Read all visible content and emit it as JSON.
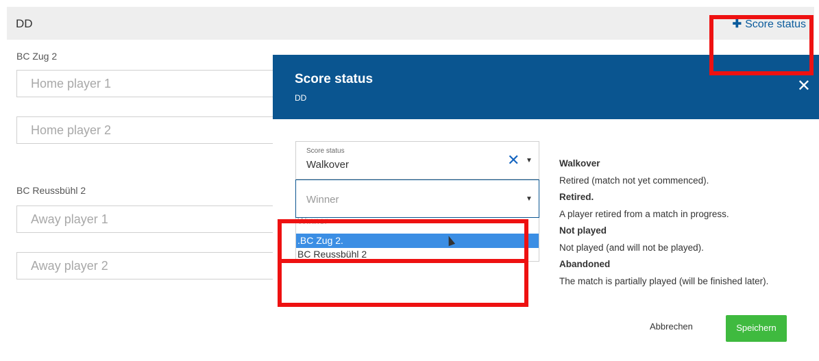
{
  "card": {
    "title": "DD",
    "score_link_plus": "✚",
    "score_link_label": "Score status"
  },
  "home": {
    "team": "BC Zug 2",
    "player1_placeholder": "Home player 1",
    "player2_placeholder": "Home player 2"
  },
  "away": {
    "team": "BC Reussbühl 2",
    "player1_placeholder": "Away player 1",
    "player2_placeholder": "Away player 2"
  },
  "modal": {
    "title": "Score status",
    "subtitle": "DD",
    "close": "✕",
    "status_field": {
      "label": "Score status",
      "value": "Walkover",
      "clear": "✕",
      "caret": "▼"
    },
    "winner_field": {
      "placeholder": "Winner",
      "caret": "▼",
      "options": [
        "Winner",
        ".BC Zug 2.",
        "BC Reussbühl 2"
      ],
      "highlighted": ".BC Zug 2."
    },
    "help": [
      {
        "heading": "Walkover",
        "text": "Retired (match not yet commenced)."
      },
      {
        "heading": "Retired.",
        "text": "A player retired from a match in progress."
      },
      {
        "heading": "Not played",
        "text": "Not played (and will not be played)."
      },
      {
        "heading": "Abandoned",
        "text": "The match is partially played (will be finished later)."
      }
    ],
    "cancel_label": "Abbrechen",
    "save_label": "Speichern"
  },
  "colors": {
    "modal_header": "#0a5590",
    "save_button": "#3fba3f",
    "highlight": "#3b8ee4",
    "annotation": "#ee1111"
  }
}
